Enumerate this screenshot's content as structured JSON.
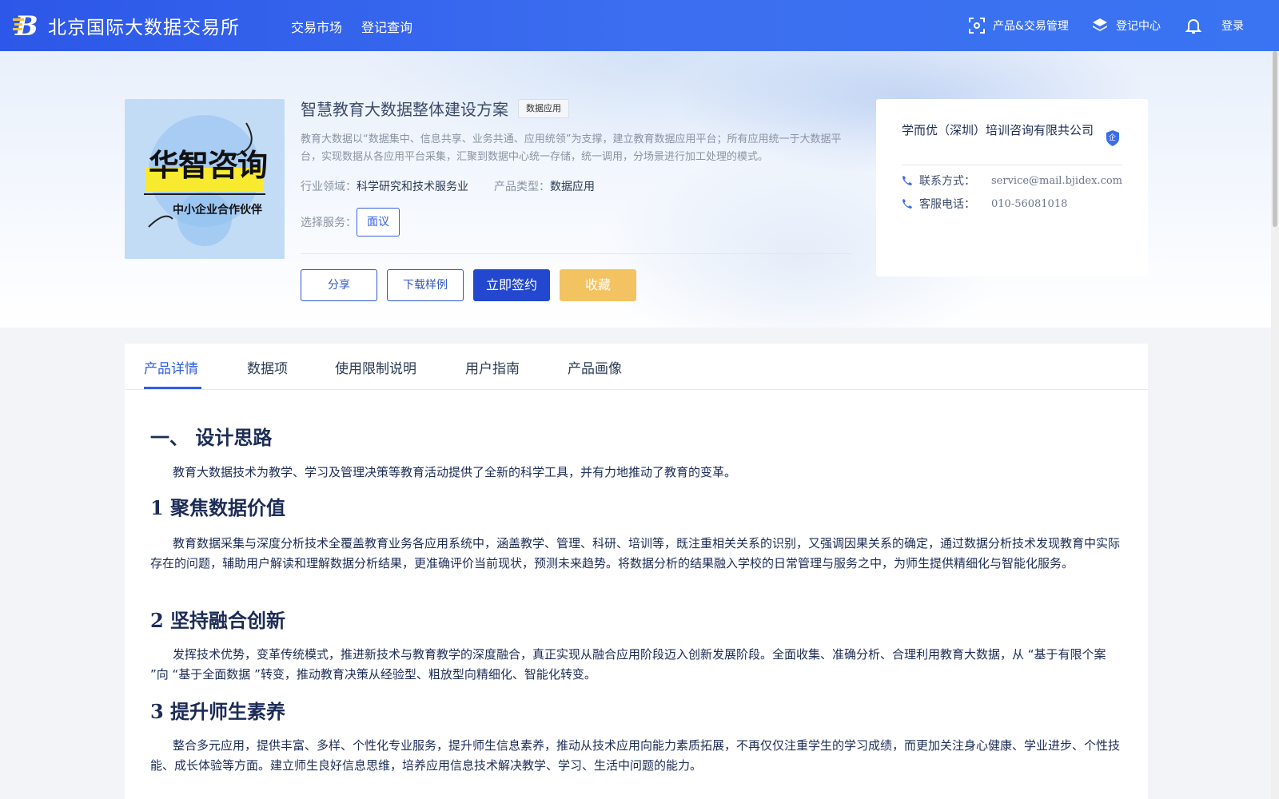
{
  "header": {
    "brand": "北京国际大数据交易所",
    "nav": [
      "交易市场",
      "登记查询"
    ],
    "right": {
      "product_mgmt": "产品&交易管理",
      "register_center": "登记中心",
      "login": "登录"
    }
  },
  "product": {
    "title": "智慧教育大数据整体建设方案",
    "tag": "数据应用",
    "description": "教育大数据以“数据集中、信息共享、业务共通、应用统领”为支撑，建立教育数据应用平台；所有应用统一于大数据平台，实现数据从各应用平台采集，汇聚到数据中心统一存储，统一调用，分场景进行加工处理的模式。",
    "industry_label": "行业领域：",
    "industry": "科学研究和技术服务业",
    "type_label": "产品类型：",
    "type": "数据应用",
    "service_label": "选择服务：",
    "service_option": "面议",
    "image_text": {
      "main": "华智咨询",
      "sub": "中小企业合作伙伴"
    },
    "buttons": {
      "share": "分享",
      "download": "下载样例",
      "sign": "立即签约",
      "favorite": "收藏"
    }
  },
  "company": {
    "name": "学而优（深圳）培训咨询有限共公司",
    "badge": "企",
    "contact_label": "联系方式：",
    "contact": "service@mail.bjidex.com",
    "phone_label": "客服电话：",
    "phone": "010-56081018"
  },
  "tabs": [
    "产品详情",
    "数据项",
    "使用限制说明",
    "用户指南",
    "产品画像"
  ],
  "detail": {
    "heading": "一、 设计思路",
    "intro": "教育大数据技术为教学、学习及管理决策等教育活动提供了全新的科学工具，并有力地推动了教育的变革。",
    "sections": [
      {
        "title": "1 聚焦数据价值",
        "text": "教育数据采集与深度分析技术全覆盖教育业务各应用系统中，涵盖教学、管理、科研、培训等，既注重相关关系的识别，又强调因果关系的确定，通过数据分析技术发现教育中实际存在的问题，辅助用户解读和理解数据分析结果，更准确评价当前现状，预测未来趋势。将数据分析的结果融入学校的日常管理与服务之中，为师生提供精细化与智能化服务。"
      },
      {
        "title": "2 坚持融合创新",
        "text": "发挥技术优势，变革传统模式，推进新技术与教育教学的深度融合，真正实现从融合应用阶段迈入创新发展阶段。全面收集、准确分析、合理利用教育大数据，从 “基于有限个案 ”向 “基于全面数据 ”转变，推动教育决策从经验型、粗放型向精细化、智能化转变。"
      },
      {
        "title": "3 提升师生素养",
        "text": "整合多元应用，提供丰富、多样、个性化专业服务，提升师生信息素养，推动从技术应用向能力素质拓展，不再仅仅注重学生的学习成绩，而更加关注身心健康、学业进步、个性技能、成长体验等方面。建立师生良好信息思维，培养应用信息技术解决教学、学习、生活中问题的能力。"
      }
    ]
  }
}
